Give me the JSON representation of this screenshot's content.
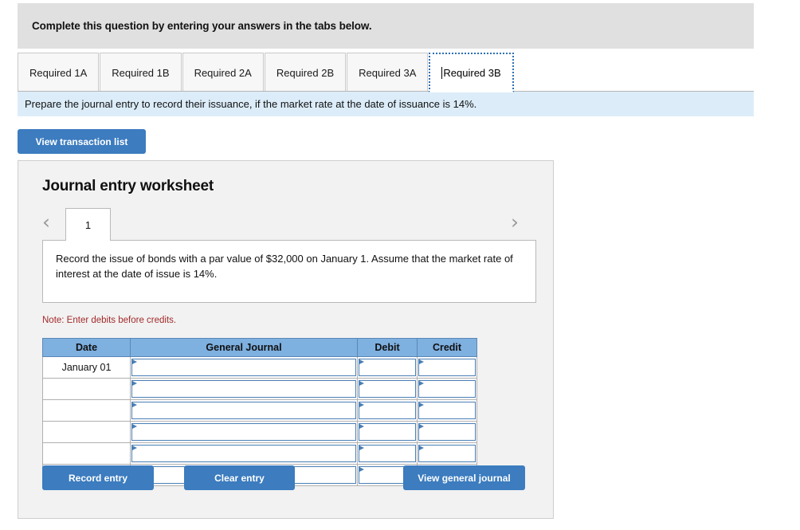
{
  "header": {
    "instruction": "Complete this question by entering your answers in the tabs below."
  },
  "tabs": {
    "items": [
      {
        "label": "Required 1A",
        "active": false
      },
      {
        "label": "Required 1B",
        "active": false
      },
      {
        "label": "Required 2A",
        "active": false
      },
      {
        "label": "Required 2B",
        "active": false
      },
      {
        "label": "Required 3A",
        "active": false
      },
      {
        "label": "Required 3B",
        "active": true
      }
    ]
  },
  "prompt": {
    "text": "Prepare the journal entry to record their issuance, if the market rate at the date of issuance is 14%."
  },
  "toolbar": {
    "view_transaction_list_label": "View transaction list"
  },
  "worksheet": {
    "title": "Journal entry worksheet",
    "nav": {
      "prev_icon": "‹",
      "next_icon": "›",
      "current_page": "1"
    },
    "description": "Record the issue of bonds with a par value of $32,000 on January 1. Assume that the market rate of interest at the date of issue is 14%.",
    "note": "Note: Enter debits before credits.",
    "table": {
      "columns": [
        "Date",
        "General Journal",
        "Debit",
        "Credit"
      ],
      "rows": [
        {
          "date": "January 01",
          "general_journal": "",
          "debit": "",
          "credit": ""
        },
        {
          "date": "",
          "general_journal": "",
          "debit": "",
          "credit": ""
        },
        {
          "date": "",
          "general_journal": "",
          "debit": "",
          "credit": ""
        },
        {
          "date": "",
          "general_journal": "",
          "debit": "",
          "credit": ""
        },
        {
          "date": "",
          "general_journal": "",
          "debit": "",
          "credit": ""
        },
        {
          "date": "",
          "general_journal": "",
          "debit": "",
          "credit": ""
        }
      ]
    },
    "actions": {
      "record_entry_label": "Record entry",
      "clear_entry_label": "Clear entry",
      "view_general_journal_label": "View general journal"
    }
  },
  "colors": {
    "banner_gray": "#e0e0e0",
    "prompt_blue": "#dcedf9",
    "button_blue": "#3c7cbf",
    "table_header_blue": "#7eb0e0",
    "note_red": "#a32929",
    "panel_gray": "#f2f2f2"
  }
}
